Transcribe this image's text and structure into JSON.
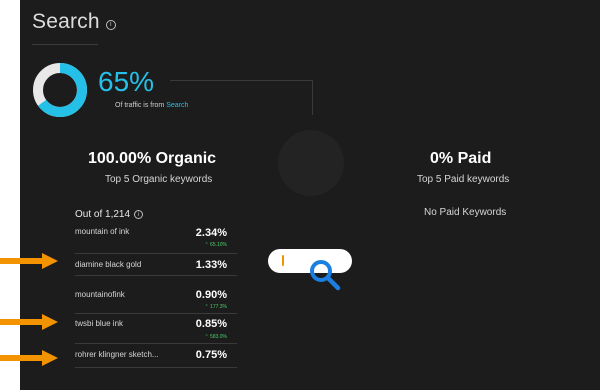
{
  "header": {
    "title": "Search",
    "info_icon": "info-icon"
  },
  "traffic": {
    "percent": "65%",
    "fraction": 0.65,
    "caption_prefix": "Of traffic is from",
    "caption_link": "Search"
  },
  "organic": {
    "heading": "100.00% Organic",
    "subheading": "Top 5 Organic keywords"
  },
  "paid": {
    "heading": "0% Paid",
    "subheading": "Top 5 Paid keywords",
    "empty_text": "No Paid Keywords"
  },
  "keywords": {
    "out_of": "Out of 1,214",
    "rows": [
      {
        "name": "mountain of ink",
        "value": "2.34%",
        "change": "⌃ 65.10%"
      },
      {
        "name": "diamine black gold",
        "value": "1.33%",
        "change": ""
      },
      {
        "name": "mountainofink",
        "value": "0.90%",
        "change": "⌃ 177.3%"
      },
      {
        "name": "twsbi blue ink",
        "value": "0.85%",
        "change": "⌃ 583.0%"
      },
      {
        "name": "rohrer klingner sketch...",
        "value": "0.75%",
        "change": ""
      }
    ]
  },
  "colors": {
    "accent": "#25c0e8",
    "arrow": "#f49300",
    "background": "#1c1c1c",
    "positive": "#4ccf6b",
    "magnifier": "#1a7fe0"
  }
}
